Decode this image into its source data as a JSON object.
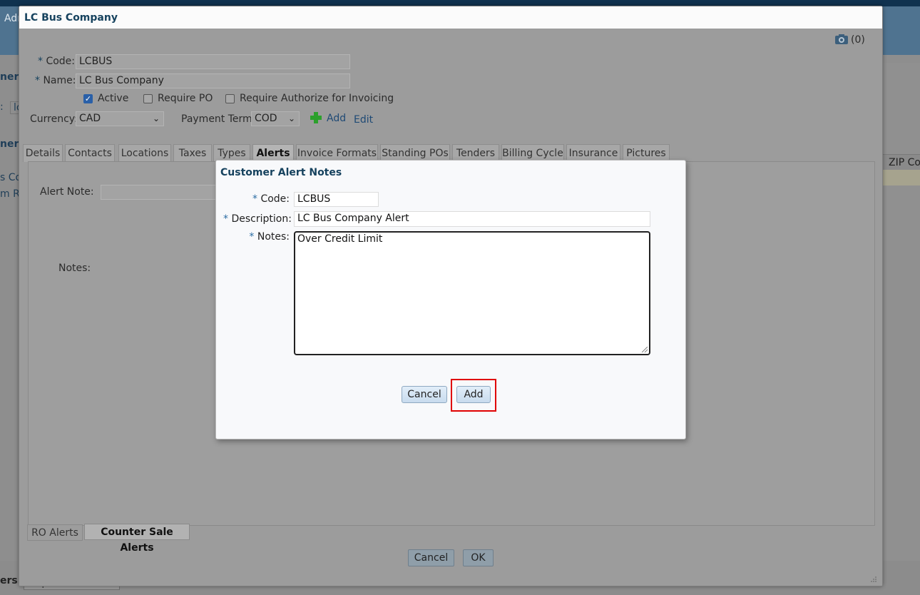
{
  "background": {
    "header_fragment": "Adı",
    "sidebar_fragment_1": "ners",
    "sidebar_fragment_2": ":",
    "sidebar_field_fragment": "lc",
    "sidebar_fragment_3": "ners",
    "row_fragment_1": "s Con",
    "row_fragment_2": "m Re",
    "grid_header": "ZIP Coc",
    "bottom_fragment": "ers",
    "bottom_button": "Import Customers"
  },
  "dialog": {
    "title": "LC Bus Company",
    "camera_count": "(0)",
    "code_label": "Code:",
    "code_value": "LCBUS",
    "name_label": "Name:",
    "name_value": "LC Bus Company",
    "active_label": "Active",
    "require_po_label": "Require PO",
    "require_auth_label": "Require Authorize for Invoicing",
    "currency_label": "Currency:",
    "currency_value": "CAD",
    "payment_term_label": "Payment Term:",
    "payment_term_value": "COD",
    "add_link": "Add",
    "edit_link": "Edit",
    "tabs": [
      "Details",
      "Contacts",
      "Locations",
      "Taxes",
      "Types",
      "Alerts",
      "Invoice Formats",
      "Standing POs",
      "Tenders",
      "Billing Cycle",
      "Insurance",
      "Pictures"
    ],
    "alert_note_label": "Alert Note:",
    "notes_label": "Notes:",
    "subtabs": [
      "RO Alerts",
      "Counter Sale Alerts"
    ],
    "cancel_label": "Cancel",
    "ok_label": "OK"
  },
  "modal": {
    "title": "Customer Alert Notes",
    "code_label": "Code:",
    "code_value": "LCBUS",
    "description_label": "Description:",
    "description_value": "LC Bus Company Alert",
    "notes_label": "Notes:",
    "notes_value": "Over Credit Limit",
    "cancel_label": "Cancel",
    "add_label": "Add",
    "required_mark": "*"
  },
  "colors": {
    "accent_title": "#16425e",
    "highlight": "#e00000",
    "add_icon": "#2ca02c"
  }
}
